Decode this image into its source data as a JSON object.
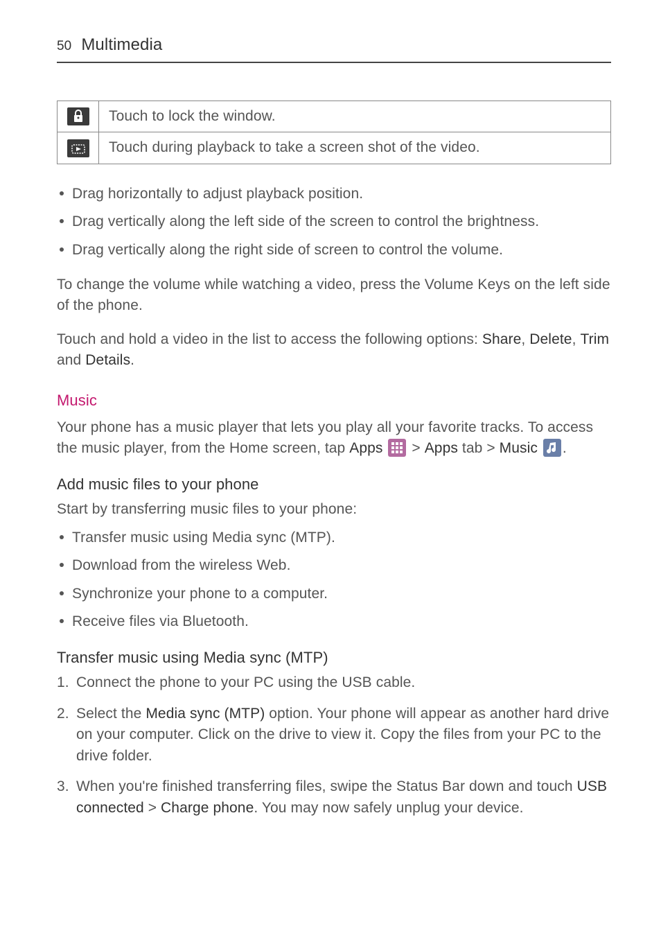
{
  "header": {
    "page_number": "50",
    "chapter_title": "Multimedia"
  },
  "icon_table": {
    "rows": [
      {
        "icon_name": "lock-icon",
        "desc": "Touch to lock the window."
      },
      {
        "icon_name": "screenshot-icon",
        "desc": "Touch during playback to take a screen shot of the video."
      }
    ]
  },
  "gesture_bullets": [
    "Drag horizontally to adjust playback position.",
    "Drag vertically along the left side of the screen to control the brightness.",
    "Drag vertically along the right side of screen to control the volume."
  ],
  "volume_para": "To change the volume while watching a video, press the Volume Keys on the left side of the phone.",
  "hold_para": {
    "pre": "Touch and hold a video in the list to access the following options: ",
    "opts": "Share",
    "sep1": ", ",
    "opt2": "Delete",
    "sep2": ", ",
    "opt3": "Trim",
    "sep3": " and ",
    "opt4": "Details",
    "post": "."
  },
  "music_section": {
    "title": "Music",
    "intro_pre": "Your phone has a music player that lets you play all your favorite tracks. To access the music player, from the Home screen, tap ",
    "apps1": "Apps",
    "gt1": " > ",
    "apps_tab": "Apps",
    "tab_word": " tab > ",
    "music_word": "Music",
    "intro_post": "."
  },
  "add_files": {
    "title": "Add music files to your phone",
    "lead": "Start by transferring music files to your phone:",
    "bullets": [
      "Transfer music using Media sync (MTP).",
      "Download from the wireless Web.",
      "Synchronize your phone to a computer.",
      "Receive files via Bluetooth."
    ]
  },
  "mtp": {
    "title": "Transfer music using Media sync (MTP)",
    "s1": "Connect the phone to your PC using the USB cable.",
    "s2_pre": "Select the ",
    "s2_bold": "Media sync (MTP)",
    "s2_post": " option. Your phone will appear as another hard drive on your computer. Click on the drive to view it. Copy the files from your PC to the drive folder.",
    "s3_pre": "When you're finished transferring files, swipe the Status Bar down and touch ",
    "s3_b1": "USB connected",
    "s3_gt": " > ",
    "s3_b2": "Charge phone",
    "s3_post": ". You may now safely unplug your device."
  }
}
